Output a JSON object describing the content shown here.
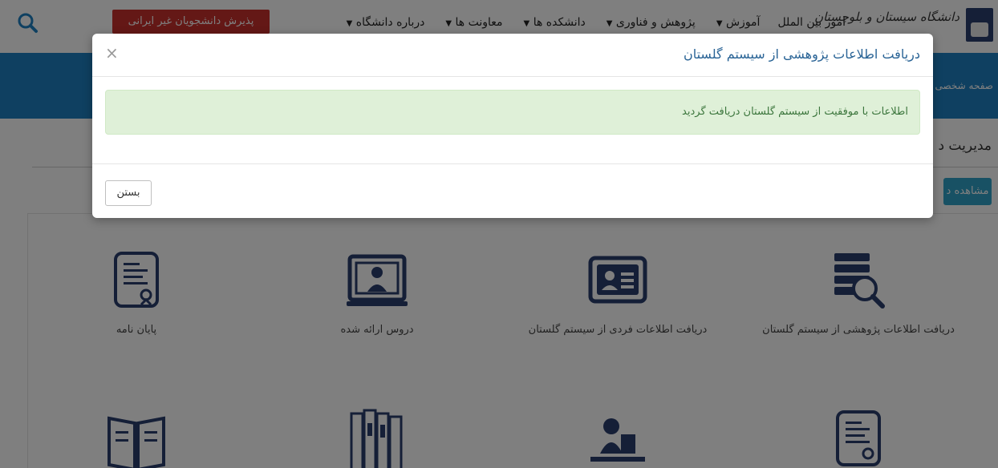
{
  "header": {
    "logo_script": "دانشگاه سیستان و بلوچستان",
    "menu": [
      "درباره دانشگاه",
      "معاونت ها",
      "دانشکده ها",
      "پژوهش و فناوری",
      "آموزش",
      "امور بین الملل"
    ],
    "intl_admission_button": "پذیرش دانشجویان غیر ایرانی",
    "search_icon": "search-icon"
  },
  "banner": {
    "breadcrumb": "صفحه شخصی ا"
  },
  "section": {
    "title": "مدیریت د",
    "view_button": "مشاهده د"
  },
  "tiles": [
    {
      "label": "دریافت اطلاعات پژوهشی از سیستم گلستان",
      "icon": "book-search-icon"
    },
    {
      "label": "دریافت اطلاعات فردی از سیستم گلستان",
      "icon": "id-card-icon"
    },
    {
      "label": "دروس ارائه شده",
      "icon": "online-class-icon"
    },
    {
      "label": "پایان نامه",
      "icon": "certificate-icon"
    },
    {
      "label": "",
      "icon": "certificate-icon"
    },
    {
      "label": "",
      "icon": "speaker-icon"
    },
    {
      "label": "",
      "icon": "books-icon"
    },
    {
      "label": "",
      "icon": "open-book-icon"
    }
  ],
  "modal": {
    "title": "دریافت اطلاعات پژوهشی از سیستم گلستان",
    "close_symbol": "×",
    "alert_message": "اطلاعات با موفقیت از سیستم گلستان دریافت گردید",
    "close_button": "بستن"
  },
  "colors": {
    "brand_blue": "#1f81c2",
    "navy_icon": "#2b3e6f",
    "danger": "#c9302c",
    "success_bg": "#dff0d8",
    "success_text": "#3c763d"
  }
}
